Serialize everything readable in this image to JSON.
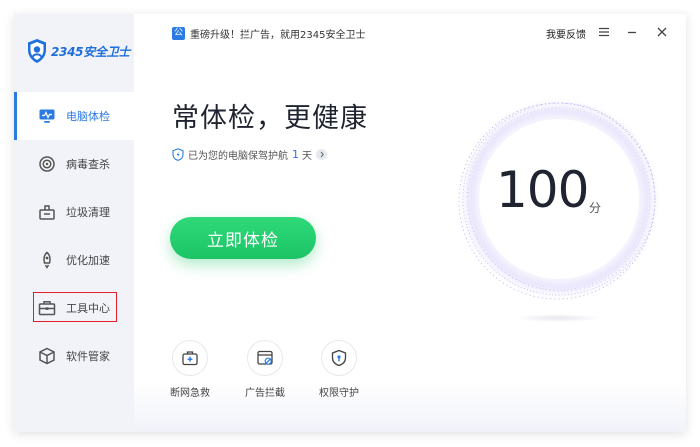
{
  "app": {
    "logo_text": "2345安全卫士"
  },
  "sidebar": {
    "items": [
      {
        "label": "电脑体检",
        "icon": "monitor-icon"
      },
      {
        "label": "病毒查杀",
        "icon": "target-icon"
      },
      {
        "label": "垃圾清理",
        "icon": "broom-box-icon"
      },
      {
        "label": "优化加速",
        "icon": "rocket-icon"
      },
      {
        "label": "工具中心",
        "icon": "toolbox-icon"
      },
      {
        "label": "软件管家",
        "icon": "cube-icon"
      }
    ],
    "active_index": 0
  },
  "topbar": {
    "notice_badge": "公",
    "notice_text": "重磅升级！拦广告，就用2345安全卫士",
    "feedback_label": "我要反馈"
  },
  "main": {
    "headline": "常体检，更健康",
    "protect_prefix": "已为您的电脑保驾护航",
    "protect_days": "1",
    "protect_unit": "天",
    "check_button": "立即体检",
    "score": "100",
    "score_unit": "分"
  },
  "tools": [
    {
      "label": "断网急救",
      "icon": "first-aid-icon"
    },
    {
      "label": "广告拦截",
      "icon": "ad-block-icon"
    },
    {
      "label": "权限守护",
      "icon": "shield-key-icon"
    }
  ],
  "colors": {
    "accent": "#2a7be4",
    "primary_button": "#22cc6e",
    "highlight": "#e0212b"
  }
}
